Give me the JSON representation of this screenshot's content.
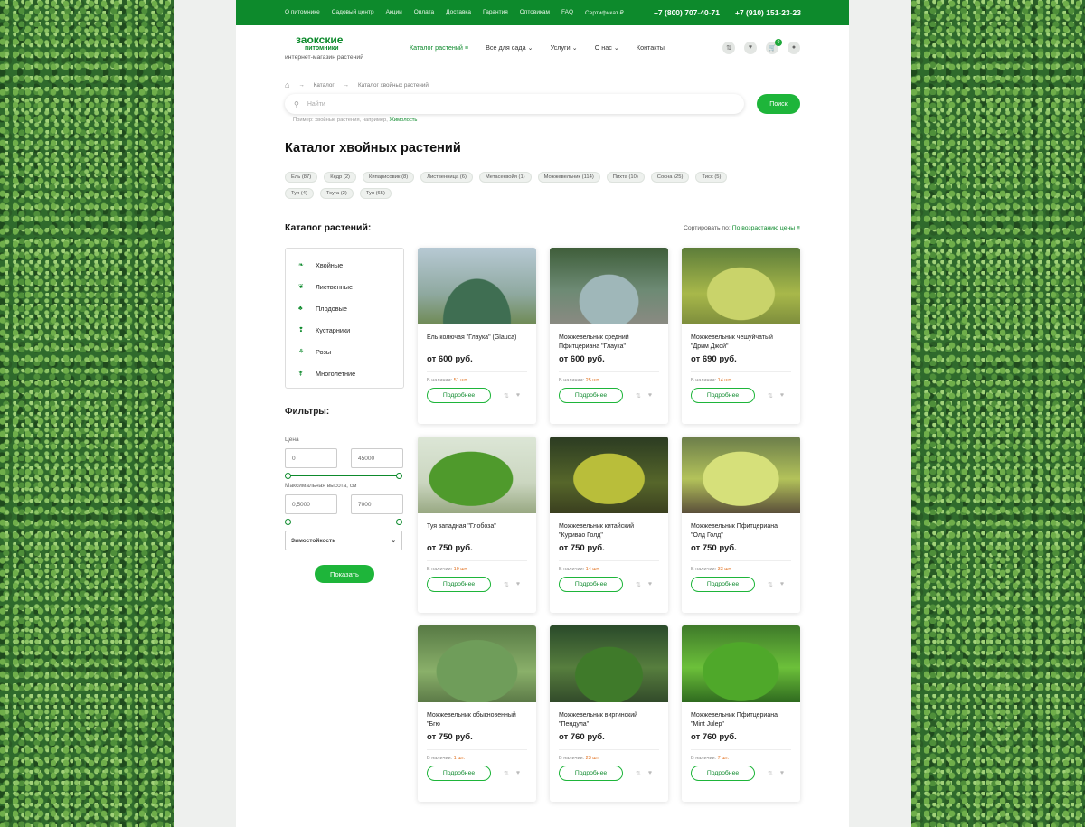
{
  "topbar": {
    "links": [
      "О питомнике",
      "Садовый центр",
      "Акции",
      "Оплата",
      "Доставка",
      "Гарантия",
      "Оптовикам",
      "FAQ",
      "Сертификат ₽"
    ],
    "phone1": "+7 (800) 707-40-71",
    "phone2": "+7 (910) 151-23-23"
  },
  "header": {
    "logo_line1": "заокские",
    "logo_line2": "питомники",
    "tagline": "интернет-магазин растений",
    "nav": [
      "Каталог растений ≡",
      "Все для сада ⌄",
      "Услуги ⌄",
      "О нас ⌄",
      "Контакты"
    ],
    "cart_count": "0"
  },
  "breadcrumb": {
    "home": "⌂",
    "sep": "→",
    "items": [
      "Каталог",
      "Каталог хвойных растений"
    ]
  },
  "search": {
    "placeholder": "Найти",
    "button": "Поиск",
    "hint_prefix": "Пример: хвойные растения, например,",
    "hint_link": "Жимолость"
  },
  "page_title": "Каталог хвойных растений",
  "tags": [
    "Ель (87)",
    "Кедр (2)",
    "Кипарисовик (8)",
    "Лиственница (6)",
    "Метасеквойя (1)",
    "Можжевельник (114)",
    "Пихта (10)",
    "Сосна (25)",
    "Тисс (5)",
    "Туя (4)",
    "Тсуга (2)",
    "Туя (65)"
  ],
  "catalog_label": "Каталог растений:",
  "sort": {
    "label": "Сортировать по:",
    "value": "По возрастанию цены ≡"
  },
  "categories": [
    {
      "label": "Хвойные",
      "icon": "❧"
    },
    {
      "label": "Лиственные",
      "icon": "❦"
    },
    {
      "label": "Плодовые",
      "icon": "♣"
    },
    {
      "label": "Кустарники",
      "icon": "❢"
    },
    {
      "label": "Розы",
      "icon": "⚘"
    },
    {
      "label": "Многолетние",
      "icon": "⚵"
    }
  ],
  "filters": {
    "title": "Фильтры:",
    "price_label": "Цена",
    "price_min": "0",
    "price_max": "45000",
    "height_label": "Максимальная высота, см",
    "height_min": "0,5000",
    "height_max": "7000",
    "hardiness": "Зимостойкость",
    "show_button": "Показать"
  },
  "product_labels": {
    "in_stock": "В наличии:",
    "more": "Подробнее"
  },
  "products": [
    {
      "name": "Ель колючая \"Глаука\" (Glauca)",
      "price": "от 600 руб.",
      "stock": "51 шт."
    },
    {
      "name": "Можжевельник средний Пфитцериана \"Глаука\"",
      "price": "от 600 руб.",
      "stock": "25 шт."
    },
    {
      "name": "Можжевельник чешуйчатый \"Дрим Джой\"",
      "price": "от 690 руб.",
      "stock": "14 шт."
    },
    {
      "name": "Туя западная \"Глобоза\"",
      "price": "от 750 руб.",
      "stock": "19 шт."
    },
    {
      "name": "Можжевельник китайский \"Куривао Голд\"",
      "price": "от 750 руб.",
      "stock": "14 шт."
    },
    {
      "name": "Можжевельник Пфитцериана \"Олд Голд\"",
      "price": "от 750 руб.",
      "stock": "33 шт."
    },
    {
      "name": "Можжевельник обыкновенный \"Бгю",
      "price": "от 750 руб.",
      "stock": "1 шт."
    },
    {
      "name": "Можжевельник виргинский \"Пендула\"",
      "price": "от 760 руб.",
      "stock": "23 шт."
    },
    {
      "name": "Можжевельник Пфитцериана \"Mint Julep\"",
      "price": "от 760 руб.",
      "stock": "7 шт."
    }
  ],
  "colors": {
    "brand": "#0d8a2c",
    "button": "#1eb53a",
    "stock": "#e0701e"
  }
}
